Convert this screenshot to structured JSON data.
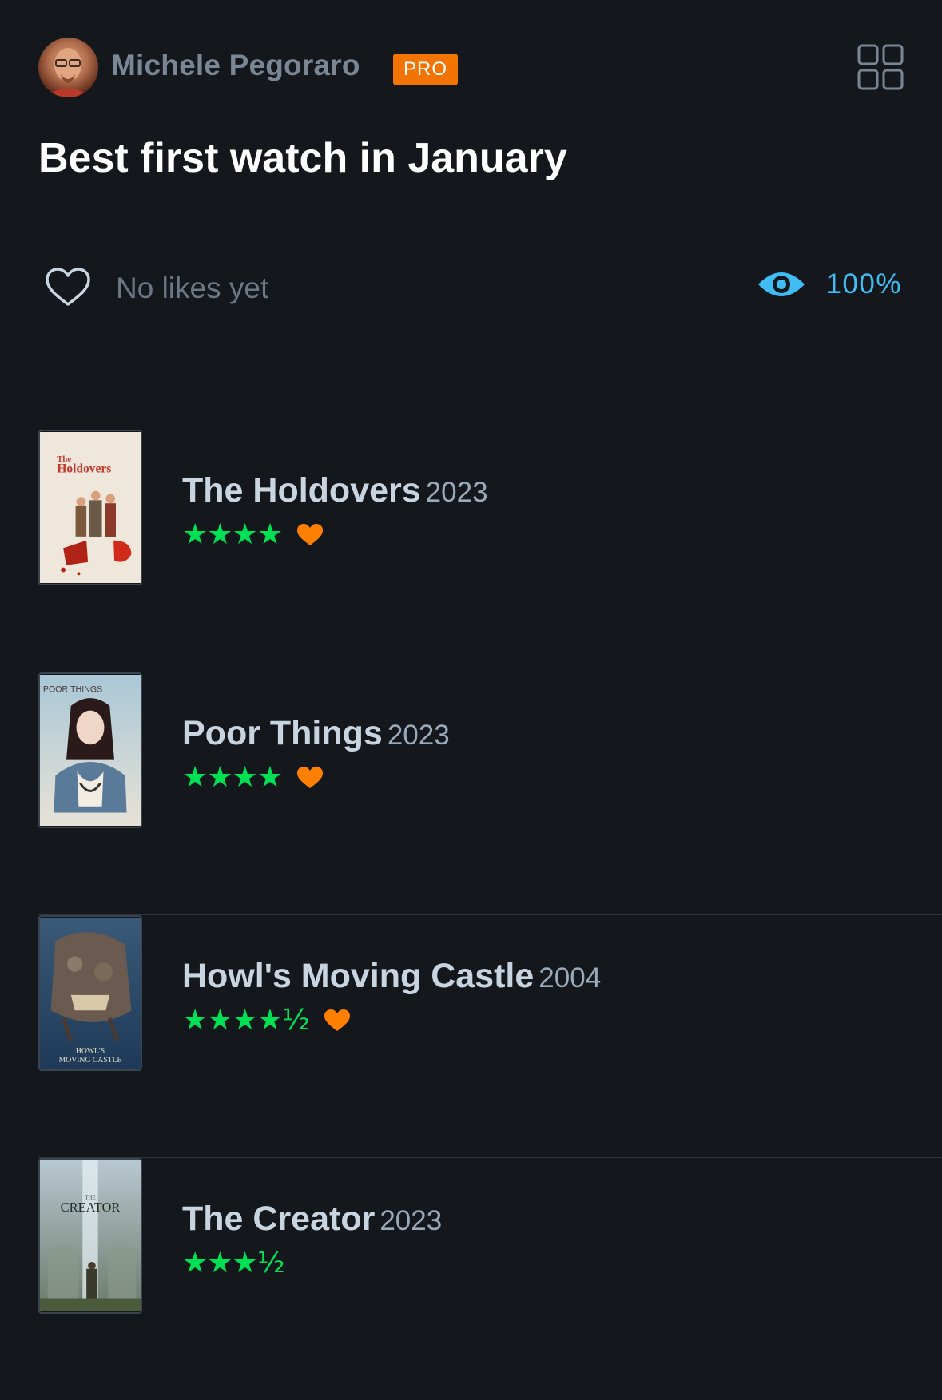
{
  "header": {
    "username": "Michele Pegoraro",
    "pro_badge": "PRO"
  },
  "list": {
    "title": "Best first watch in January"
  },
  "meta": {
    "likes_text": "No likes yet",
    "watched_percent": "100%"
  },
  "colors": {
    "background": "#14181c",
    "pro_badge": "#f27405",
    "star_green": "#00e054",
    "heart_orange": "#ff8000",
    "watched_blue": "#40bcf4"
  },
  "films": [
    {
      "title": "The Holdovers",
      "year": "2023",
      "stars": "★★★★",
      "liked": true,
      "poster_text": "The Holdovers"
    },
    {
      "title": "Poor Things",
      "year": "2023",
      "stars": "★★★★",
      "liked": true,
      "poster_text": "POOR THINGS"
    },
    {
      "title": "Howl's Moving Castle",
      "year": "2004",
      "stars": "★★★★½",
      "liked": true,
      "poster_text": "HOWL'S MOVING CASTLE"
    },
    {
      "title": "The Creator",
      "year": "2023",
      "stars": "★★★½",
      "liked": false,
      "poster_text": "THE CREATOR"
    }
  ]
}
